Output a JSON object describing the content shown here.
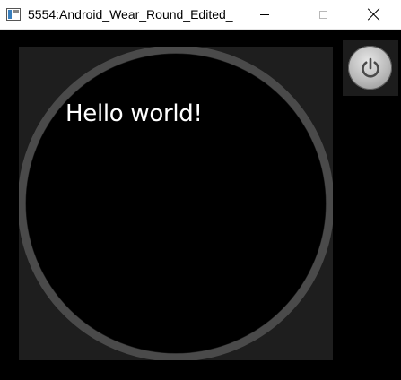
{
  "window": {
    "title": "5554:Android_Wear_Round_Edited_",
    "icon": "emulator-app-icon",
    "controls": [
      "minimize-icon",
      "maximize-icon",
      "close-icon"
    ]
  },
  "watch": {
    "shape": "round",
    "greeting": "Hello world!"
  },
  "side_panel": {
    "power_icon": "power-icon"
  },
  "colors": {
    "screen_bg": "#1e1e1e",
    "bezel_ring": "#4a4a4a",
    "face": "#000000",
    "text": "#ffffff"
  }
}
